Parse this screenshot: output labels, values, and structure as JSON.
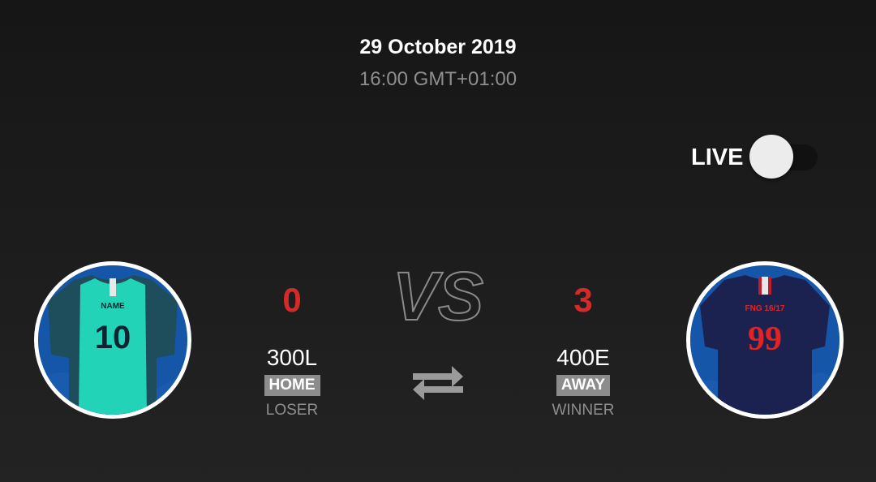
{
  "match": {
    "date": "29 October 2019",
    "time": "16:00 GMT+01:00",
    "live_label": "LIVE",
    "live_enabled": false,
    "vs_label": "VS"
  },
  "home": {
    "score": "0",
    "name": "300L",
    "side": "HOME",
    "result": "LOSER",
    "jersey_text": "NAME",
    "jersey_number": "10"
  },
  "away": {
    "score": "3",
    "name": "400E",
    "side": "AWAY",
    "result": "WINNER",
    "jersey_text": "FNG 16/17",
    "jersey_number": "99"
  },
  "icons": {
    "swap": "swap-arrows-icon"
  },
  "colors": {
    "score": "#d42a2a",
    "badge": "#8c8c8c",
    "muted": "#8e8e8e"
  }
}
